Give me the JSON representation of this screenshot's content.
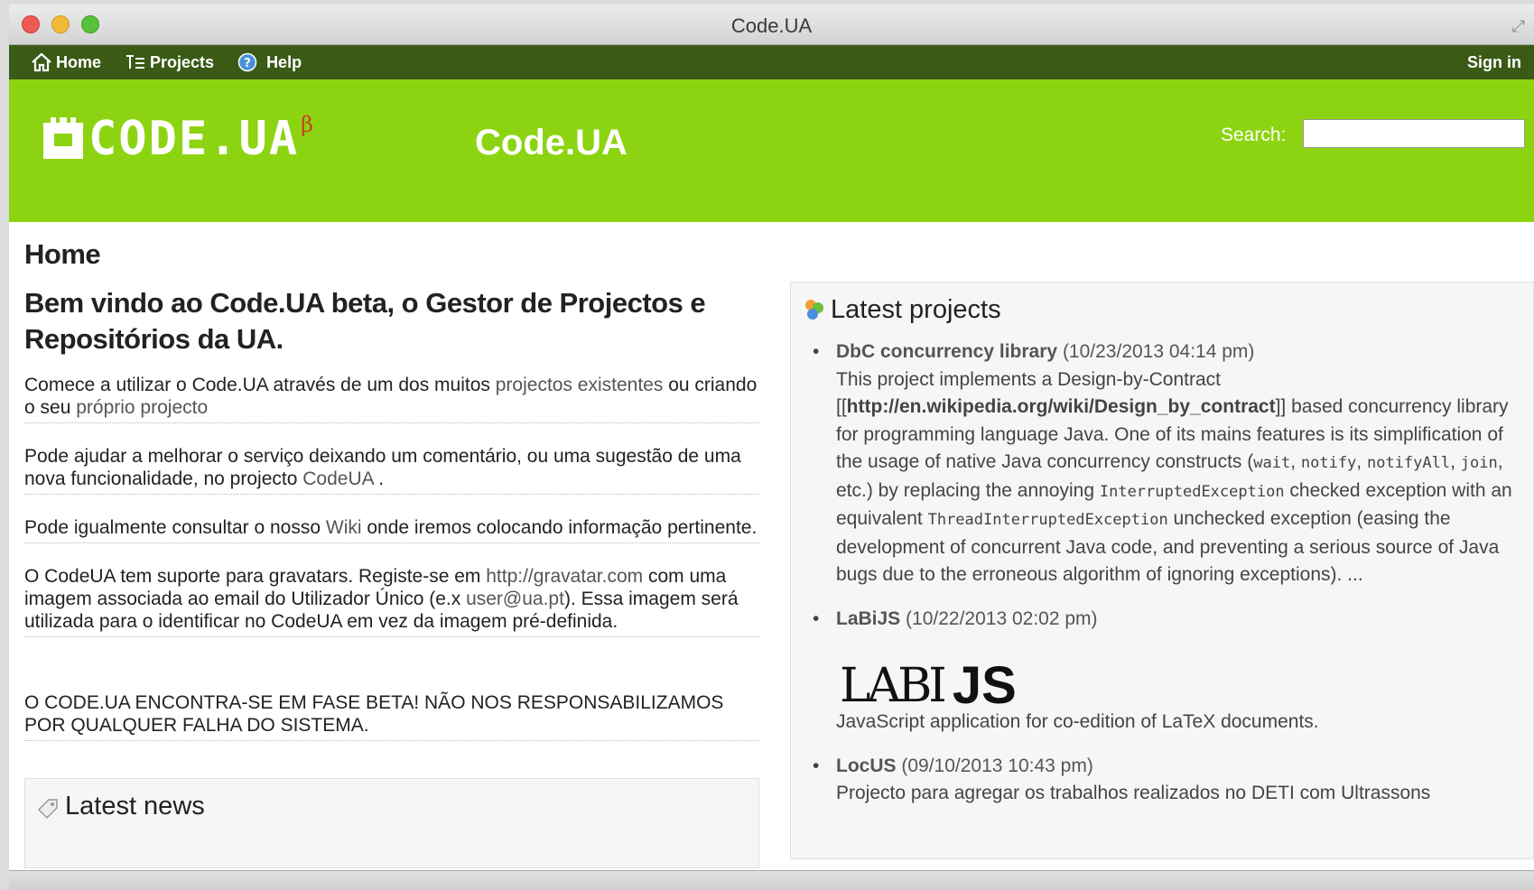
{
  "window": {
    "title": "Code.UA"
  },
  "nav": {
    "home": "Home",
    "projects": "Projects",
    "help": "Help",
    "sign_in": "Sign in"
  },
  "header": {
    "logo_text": "CODE.UA",
    "logo_beta": "β",
    "site_title": "Code.UA",
    "search_label": "Search:",
    "search_value": ""
  },
  "main": {
    "page_heading": "Home",
    "welcome": "Bem vindo ao Code.UA beta, o Gestor de Projectos e Repositórios da UA.",
    "p1_text_a": "Comece a utilizar o Code.UA através de um dos muitos ",
    "p1_link_a": "projectos existentes",
    "p1_text_b": " ou criando o seu ",
    "p1_link_b": "próprio projecto",
    "p2_text_a": "Pode ajudar a melhorar o serviço deixando um comentário, ou uma sugestão de uma nova funcionalidade, no projecto ",
    "p2_link": "CodeUA",
    "p2_text_b": " .",
    "p3_text_a": "Pode igualmente consultar o nosso ",
    "p3_link": "Wiki",
    "p3_text_b": " onde iremos colocando informação pertinente.",
    "p4_text_a": "O CodeUA tem suporte para gravatars. Registe-se em ",
    "p4_link_a": "http://gravatar.com",
    "p4_text_b": " com uma imagem associada ao email do Utilizador Único (e.x ",
    "p4_link_b": "user@ua.pt",
    "p4_text_c": "). Essa imagem será utilizada para o identificar no CodeUA em vez da imagem pré-definida.",
    "beta_note": "O CODE.UA ENCONTRA-SE EM FASE BETA! NÃO NOS RESPONSABILIZAMOS POR QUALQUER FALHA DO SISTEMA.",
    "latest_news_title": "Latest news"
  },
  "latest_projects": {
    "title": "Latest projects",
    "items": [
      {
        "name": "DbC concurrency library",
        "date": "(10/23/2013 04:14 pm)",
        "desc_a": "This project implements a Design-by-Contract [[",
        "desc_link": "http://en.wikipedia.org/wiki/Design_by_contract",
        "desc_b": "]] based concurrency library for programming language Java. One of its mains features is its simplification of the usage of native Java concurrency constructs (",
        "code_wait": "wait",
        "code_notify": "notify",
        "code_notifyall": "notifyAll",
        "code_join": "join",
        "desc_c": ", etc.) by replacing the annoying ",
        "code_ie": "InterruptedException",
        "desc_d": " checked exception with an equivalent ",
        "code_tie": "ThreadInterruptedException",
        "desc_e": " unchecked exception (easing the development of concurrent Java code, and preventing a serious source of Java bugs due to the erroneous algorithm of ignoring exceptions). ..."
      },
      {
        "name": "LaBiJS",
        "date": "(10/22/2013 02:02 pm)",
        "logo_lab": "LABI",
        "logo_js": "JS",
        "desc": "JavaScript application for co-edition of LaTeX documents."
      },
      {
        "name": "LocUS",
        "date": "(09/10/2013 10:43 pm)",
        "desc": "Projecto para agregar os trabalhos realizados no DETI com Ultrassons"
      }
    ]
  },
  "colors": {
    "nav_bg": "#3a5a16",
    "header_bg": "#8cd411",
    "logo_beta": "#c8401e"
  }
}
